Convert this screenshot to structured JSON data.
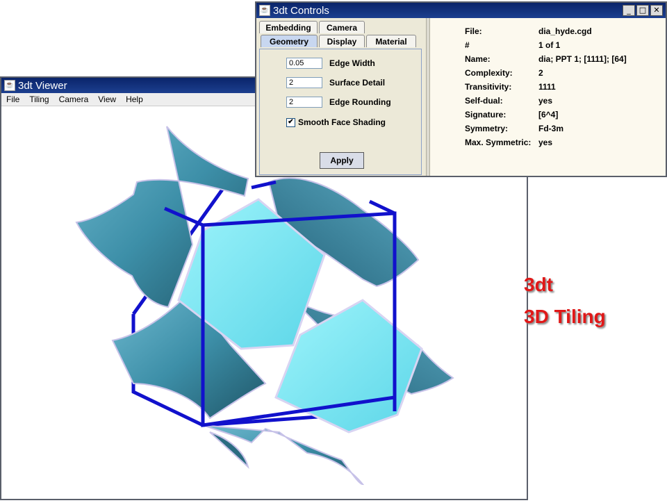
{
  "viewer": {
    "title": "3dt Viewer",
    "menu": [
      "File",
      "Tiling",
      "Camera",
      "View",
      "Help"
    ]
  },
  "controls": {
    "title": "3dt Controls",
    "window_buttons": [
      "_",
      "□",
      "✕"
    ],
    "tabs_row1": [
      "Embedding",
      "Camera"
    ],
    "tabs_row2": [
      "Geometry",
      "Display",
      "Material"
    ],
    "active_tab": "Geometry",
    "fields": [
      {
        "value": "0.05",
        "label": "Edge Width"
      },
      {
        "value": "2",
        "label": "Surface Detail"
      },
      {
        "value": "2",
        "label": "Edge Rounding"
      }
    ],
    "checkbox": {
      "label": "Smooth Face Shading",
      "checked": true,
      "mark": "✔"
    },
    "apply_label": "Apply",
    "info": [
      {
        "key": "File:",
        "value": "dia_hyde.cgd"
      },
      {
        "key": "#",
        "value": "1 of 1"
      },
      {
        "key": "Name:",
        "value": "dia; PPT 1; [1111]; [64]"
      },
      {
        "key": "Complexity:",
        "value": "2"
      },
      {
        "key": "Transitivity:",
        "value": "1111"
      },
      {
        "key": "Self-dual:",
        "value": "yes"
      },
      {
        "key": "Signature:",
        "value": "[6^4]"
      },
      {
        "key": "Symmetry:",
        "value": "Fd-3m"
      },
      {
        "key": "Max. Symmetric:",
        "value": "yes"
      }
    ]
  },
  "side_text": {
    "line1": "3dt",
    "line2": "3D Tiling"
  },
  "colors": {
    "title_bar": "#0a246a",
    "tile": "#5aa8c0",
    "tile_light": "#7fe6f2",
    "cube": "#1111cc",
    "side_text": "#e01818"
  }
}
